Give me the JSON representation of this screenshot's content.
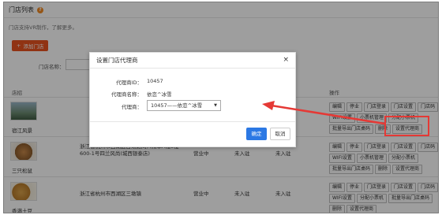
{
  "page": {
    "title": "门店列表",
    "notice": "门店支持VR制作，了解更多。",
    "add_button": "添加门店",
    "filter_label": "门店名称："
  },
  "table": {
    "headers": {
      "store": "店招",
      "operations": "操作"
    },
    "rows": [
      {
        "name": "宿江风景",
        "address": "",
        "status": "",
        "connect": "",
        "ops": [
          "编辑",
          "停业",
          "门店登录",
          "门店设置",
          "门店码",
          "WIFI设置",
          "小票机管理",
          "分配小票机",
          "批量导出门店桌码",
          "删除",
          "设置代理商"
        ]
      },
      {
        "name": "三只松鼠",
        "address": "浙江省杭州市西湖区古荡路同人精华A幢3楼600-1号四兰风尚(城西银泰店)",
        "status": "营业中",
        "connect": "未入驻",
        "connect2": "未入驻",
        "ops": [
          "编辑",
          "停业",
          "门店登录",
          "门店设置",
          "门店码",
          "WIFI设置",
          "小票机管理",
          "分配小票机",
          "批量导出门店桌码",
          "删除",
          "设置代理商"
        ]
      },
      {
        "name": "香满土豆",
        "address": "浙江省杭州市西湖区三墩镇",
        "status": "营业中",
        "connect": "未入驻",
        "connect2": "未入驻",
        "ops": [
          "编辑",
          "停业",
          "门店登录",
          "门店设置",
          "门店码",
          "WIFI设置",
          "分配小票机",
          "批量导出门店桌码",
          "删除",
          "设置代理商"
        ]
      }
    ]
  },
  "modal": {
    "title": "设置门店代理商",
    "close": "×",
    "agent_id_label": "代理商ID：",
    "agent_id_value": "10457",
    "agent_name_label": "代理商名称：",
    "agent_name_value": "依恋^冰雪",
    "agent_select_label": "代理商：",
    "agent_select_value": "10457——依恋^冰雪",
    "confirm": "确定",
    "cancel": "取消"
  },
  "colors": {
    "accent": "#e8531f",
    "primary": "#2b78e4",
    "highlight": "#e53935"
  }
}
